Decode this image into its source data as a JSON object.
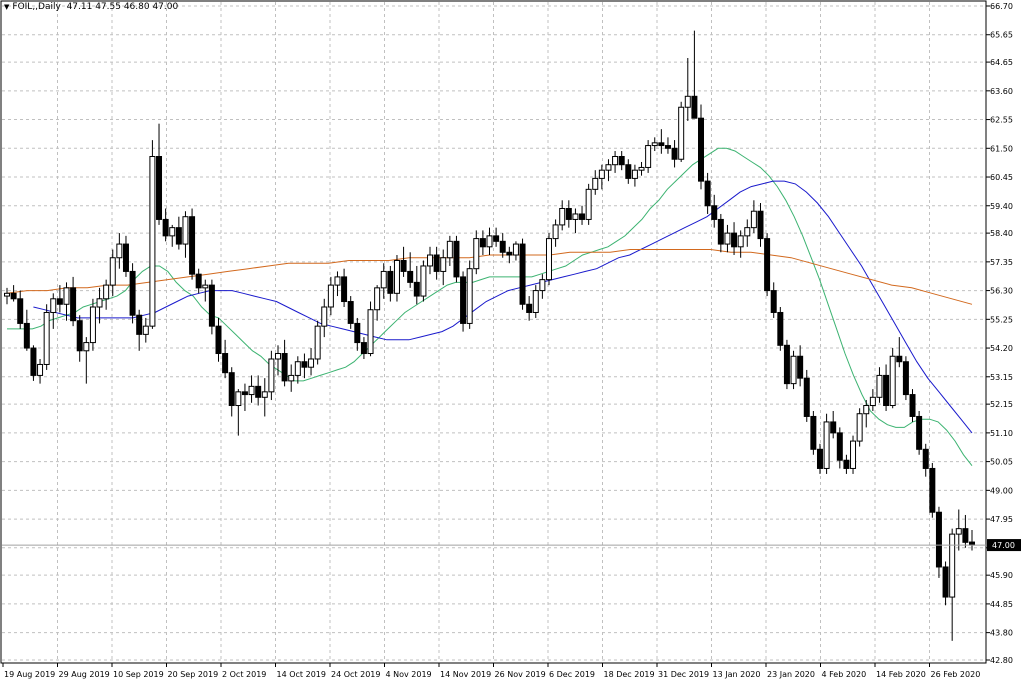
{
  "header": {
    "symbol": "FOIL,,Daily",
    "ohlc": "47.11 47.55 46.80 47.00"
  },
  "chart_data": {
    "type": "candlestick",
    "title": "FOIL,,Daily",
    "y_ticks": [
      "66.70",
      "65.65",
      "64.65",
      "63.60",
      "62.55",
      "61.50",
      "60.45",
      "59.40",
      "58.40",
      "57.35",
      "56.30",
      "55.25",
      "54.20",
      "53.15",
      "52.15",
      "51.10",
      "50.05",
      "49.00",
      "47.95",
      "46.90",
      "45.90",
      "44.85",
      "43.80",
      "42.80"
    ],
    "ylim": [
      42.8,
      66.7
    ],
    "x_ticks": [
      "19 Aug 2019",
      "29 Aug 2019",
      "10 Sep 2019",
      "20 Sep 2019",
      "2 Oct 2019",
      "14 Oct 2019",
      "24 Oct 2019",
      "4 Nov 2019",
      "14 Nov 2019",
      "26 Nov 2019",
      "6 Dec 2019",
      "18 Dec 2019",
      "31 Dec 2019",
      "13 Jan 2020",
      "23 Jan 2020",
      "4 Feb 2020",
      "14 Feb 2020",
      "26 Feb 2020"
    ],
    "current_price": "47.00",
    "grid": true,
    "colors": {
      "bull": "#ffffff",
      "bear": "#000000",
      "ma_fast": "#3cb371",
      "ma_mid": "#1a1acc",
      "ma_slow": "#d2691e",
      "grid": "#c0c0c0"
    },
    "candles": [
      [
        56.1,
        56.4,
        55.8,
        56.2
      ],
      [
        56.2,
        56.5,
        55.9,
        56.0
      ],
      [
        56.0,
        56.3,
        54.9,
        55.1
      ],
      [
        55.1,
        55.6,
        54.1,
        54.2
      ],
      [
        54.2,
        54.3,
        53.0,
        53.2
      ],
      [
        53.2,
        53.8,
        52.9,
        53.6
      ],
      [
        53.6,
        55.8,
        53.4,
        55.5
      ],
      [
        55.5,
        56.2,
        54.9,
        56.0
      ],
      [
        56.0,
        56.5,
        55.5,
        55.8
      ],
      [
        55.8,
        56.6,
        55.2,
        56.4
      ],
      [
        56.4,
        56.8,
        55.0,
        55.2
      ],
      [
        55.2,
        55.4,
        53.7,
        54.1
      ],
      [
        54.1,
        54.6,
        52.9,
        54.4
      ],
      [
        54.4,
        56.0,
        54.1,
        55.7
      ],
      [
        55.7,
        56.4,
        55.1,
        56.0
      ],
      [
        56.0,
        56.7,
        55.6,
        56.5
      ],
      [
        56.5,
        57.8,
        56.1,
        57.5
      ],
      [
        57.5,
        58.4,
        57.1,
        58.0
      ],
      [
        58.0,
        58.3,
        56.8,
        57.0
      ],
      [
        57.0,
        57.3,
        55.1,
        55.4
      ],
      [
        55.4,
        55.6,
        54.1,
        54.7
      ],
      [
        54.7,
        55.3,
        54.4,
        55.0
      ],
      [
        55.0,
        61.8,
        54.9,
        61.2
      ],
      [
        61.2,
        62.4,
        58.7,
        58.9
      ],
      [
        58.9,
        59.3,
        58.1,
        58.3
      ],
      [
        58.3,
        58.7,
        57.9,
        58.6
      ],
      [
        58.6,
        59.0,
        57.8,
        58.0
      ],
      [
        58.0,
        59.2,
        57.5,
        59.0
      ],
      [
        59.0,
        59.3,
        56.7,
        56.9
      ],
      [
        56.9,
        57.1,
        56.2,
        56.4
      ],
      [
        56.4,
        56.7,
        55.9,
        56.5
      ],
      [
        56.5,
        56.7,
        54.7,
        55.0
      ],
      [
        55.0,
        55.3,
        53.7,
        54.0
      ],
      [
        54.0,
        54.5,
        53.1,
        53.3
      ],
      [
        53.3,
        53.5,
        51.7,
        52.1
      ],
      [
        52.1,
        52.7,
        51.0,
        52.6
      ],
      [
        52.6,
        52.9,
        51.9,
        52.5
      ],
      [
        52.5,
        53.2,
        52.2,
        52.8
      ],
      [
        52.8,
        53.2,
        52.1,
        52.4
      ],
      [
        52.4,
        53.1,
        51.7,
        52.6
      ],
      [
        52.6,
        54.1,
        52.3,
        53.8
      ],
      [
        53.8,
        54.3,
        53.2,
        54.0
      ],
      [
        54.0,
        54.5,
        52.8,
        53.0
      ],
      [
        53.0,
        53.6,
        52.6,
        53.2
      ],
      [
        53.2,
        53.9,
        52.9,
        53.7
      ],
      [
        53.7,
        54.0,
        53.1,
        53.5
      ],
      [
        53.5,
        54.2,
        53.2,
        53.8
      ],
      [
        53.8,
        55.2,
        53.6,
        55.0
      ],
      [
        55.0,
        56.0,
        54.6,
        55.7
      ],
      [
        55.7,
        56.8,
        55.4,
        56.5
      ],
      [
        56.5,
        57.0,
        56.1,
        56.8
      ],
      [
        56.8,
        57.1,
        55.7,
        55.9
      ],
      [
        55.9,
        56.1,
        54.9,
        55.1
      ],
      [
        55.1,
        55.3,
        54.1,
        54.4
      ],
      [
        54.4,
        54.6,
        53.8,
        54.0
      ],
      [
        54.0,
        55.9,
        53.9,
        55.6
      ],
      [
        55.6,
        56.5,
        55.2,
        56.4
      ],
      [
        56.4,
        57.3,
        56.0,
        57.0
      ],
      [
        57.0,
        57.2,
        55.9,
        56.2
      ],
      [
        56.2,
        57.6,
        55.9,
        57.4
      ],
      [
        57.4,
        57.9,
        56.8,
        57.0
      ],
      [
        57.0,
        57.7,
        56.4,
        56.6
      ],
      [
        56.6,
        57.2,
        55.8,
        56.1
      ],
      [
        56.1,
        57.4,
        55.9,
        57.2
      ],
      [
        57.2,
        57.9,
        56.9,
        57.6
      ],
      [
        57.6,
        57.9,
        56.7,
        57.0
      ],
      [
        57.0,
        57.8,
        56.5,
        57.5
      ],
      [
        57.5,
        58.3,
        57.2,
        58.1
      ],
      [
        58.1,
        58.3,
        56.6,
        56.8
      ],
      [
        56.8,
        57.0,
        54.8,
        55.1
      ],
      [
        55.1,
        57.4,
        54.9,
        57.1
      ],
      [
        57.1,
        58.5,
        56.9,
        58.2
      ],
      [
        58.2,
        58.5,
        57.6,
        57.9
      ],
      [
        57.9,
        58.6,
        57.6,
        58.3
      ],
      [
        58.3,
        58.6,
        57.9,
        58.1
      ],
      [
        58.1,
        58.4,
        57.5,
        57.7
      ],
      [
        57.7,
        57.9,
        57.3,
        57.6
      ],
      [
        57.6,
        58.1,
        57.4,
        58.0
      ],
      [
        58.0,
        58.2,
        55.6,
        55.8
      ],
      [
        55.8,
        56.1,
        55.2,
        55.5
      ],
      [
        55.5,
        56.5,
        55.3,
        56.3
      ],
      [
        56.3,
        56.9,
        56.0,
        56.7
      ],
      [
        56.7,
        58.4,
        56.5,
        58.2
      ],
      [
        58.2,
        58.9,
        57.9,
        58.7
      ],
      [
        58.7,
        59.6,
        58.5,
        59.3
      ],
      [
        59.3,
        59.6,
        58.6,
        58.9
      ],
      [
        58.9,
        59.3,
        58.4,
        59.1
      ],
      [
        59.1,
        59.4,
        58.7,
        58.9
      ],
      [
        58.9,
        60.2,
        58.7,
        60.0
      ],
      [
        60.0,
        60.7,
        59.8,
        60.4
      ],
      [
        60.4,
        60.9,
        60.0,
        60.7
      ],
      [
        60.7,
        61.1,
        60.3,
        60.9
      ],
      [
        60.9,
        61.4,
        60.6,
        61.2
      ],
      [
        61.2,
        61.4,
        60.7,
        60.9
      ],
      [
        60.9,
        61.1,
        60.2,
        60.4
      ],
      [
        60.4,
        60.9,
        60.1,
        60.7
      ],
      [
        60.7,
        61.0,
        60.5,
        60.8
      ],
      [
        60.8,
        61.8,
        60.6,
        61.6
      ],
      [
        61.6,
        61.9,
        61.4,
        61.7
      ],
      [
        61.7,
        62.2,
        61.3,
        61.6
      ],
      [
        61.6,
        61.9,
        61.3,
        61.5
      ],
      [
        61.5,
        61.8,
        60.8,
        61.1
      ],
      [
        61.1,
        63.2,
        61.0,
        63.0
      ],
      [
        63.0,
        64.8,
        62.5,
        63.4
      ],
      [
        63.4,
        65.8,
        62.8,
        62.6
      ],
      [
        62.6,
        63.1,
        60.0,
        60.3
      ],
      [
        60.3,
        60.6,
        59.1,
        59.4
      ],
      [
        59.4,
        59.8,
        58.6,
        58.9
      ],
      [
        58.9,
        59.1,
        57.7,
        58.0
      ],
      [
        58.0,
        58.7,
        57.7,
        58.4
      ],
      [
        58.4,
        58.8,
        57.6,
        57.9
      ],
      [
        57.9,
        58.5,
        57.5,
        58.3
      ],
      [
        58.3,
        58.9,
        57.9,
        58.6
      ],
      [
        58.6,
        59.6,
        58.4,
        59.2
      ],
      [
        59.2,
        59.5,
        57.9,
        58.2
      ],
      [
        58.2,
        58.4,
        56.1,
        56.3
      ],
      [
        56.3,
        56.6,
        55.3,
        55.5
      ],
      [
        55.5,
        55.7,
        54.1,
        54.3
      ],
      [
        54.3,
        54.5,
        52.7,
        52.9
      ],
      [
        52.9,
        54.1,
        52.7,
        53.9
      ],
      [
        53.9,
        54.3,
        52.8,
        53.1
      ],
      [
        53.1,
        53.4,
        51.5,
        51.7
      ],
      [
        51.7,
        51.9,
        50.3,
        50.5
      ],
      [
        50.5,
        50.7,
        49.6,
        49.8
      ],
      [
        49.8,
        51.8,
        49.6,
        51.5
      ],
      [
        51.5,
        51.9,
        50.9,
        51.1
      ],
      [
        51.1,
        51.3,
        49.8,
        50.1
      ],
      [
        50.1,
        50.3,
        49.6,
        49.8
      ],
      [
        49.8,
        51.0,
        49.6,
        50.8
      ],
      [
        50.8,
        52.0,
        50.6,
        51.8
      ],
      [
        51.8,
        52.3,
        51.3,
        52.1
      ],
      [
        52.1,
        52.7,
        51.9,
        52.4
      ],
      [
        52.4,
        53.5,
        52.2,
        53.2
      ],
      [
        53.2,
        53.6,
        51.9,
        52.1
      ],
      [
        52.1,
        54.2,
        52.0,
        53.9
      ],
      [
        53.9,
        54.6,
        53.5,
        53.7
      ],
      [
        53.7,
        53.9,
        52.3,
        52.5
      ],
      [
        52.5,
        52.7,
        51.5,
        51.7
      ],
      [
        51.7,
        51.9,
        50.3,
        50.5
      ],
      [
        50.5,
        50.7,
        49.5,
        49.8
      ],
      [
        49.8,
        50.0,
        48.0,
        48.2
      ],
      [
        48.2,
        48.4,
        45.8,
        46.2
      ],
      [
        46.2,
        46.4,
        44.8,
        45.1
      ],
      [
        45.1,
        47.6,
        43.5,
        47.4
      ],
      [
        47.4,
        48.3,
        46.8,
        47.6
      ],
      [
        47.6,
        48.1,
        46.9,
        47.1
      ],
      [
        47.11,
        47.55,
        46.8,
        47.0
      ]
    ],
    "ma_fast": [
      54.9,
      54.9,
      54.9,
      54.9,
      55.0,
      55.2,
      55.3,
      55.4,
      55.5,
      55.7,
      55.8,
      55.9,
      56.0,
      56.1,
      56.3,
      56.7,
      57.0,
      57.2,
      57.2,
      57.0,
      56.6,
      56.3,
      56.1,
      55.7,
      55.4,
      55.3,
      55.0,
      54.7,
      54.4,
      54.1,
      53.9,
      53.6,
      53.4,
      53.2,
      53.0,
      53.0,
      53.1,
      53.2,
      53.3,
      53.4,
      53.5,
      53.7,
      54.0,
      54.3,
      54.6,
      54.9,
      55.2,
      55.5,
      55.7,
      55.9,
      56.1,
      56.3,
      56.5,
      56.6,
      56.6,
      56.6,
      56.7,
      56.8,
      56.8,
      56.8,
      56.8,
      56.8,
      56.8,
      56.9,
      57.0,
      57.1,
      57.2,
      57.4,
      57.6,
      57.7,
      57.8,
      57.9,
      58.1,
      58.3,
      58.6,
      58.9,
      59.3,
      59.6,
      60.0,
      60.3,
      60.6,
      60.9,
      61.1,
      61.3,
      61.5,
      61.5,
      61.4,
      61.2,
      61.0,
      60.8,
      60.5,
      60.1,
      59.6,
      59.0,
      58.3,
      57.5,
      56.7,
      55.8,
      54.9,
      54.0,
      53.2,
      52.5,
      51.9,
      51.6,
      51.4,
      51.3,
      51.3,
      51.5,
      51.6,
      51.6,
      51.5,
      51.2,
      50.8,
      50.3,
      49.9
    ],
    "ma_fast_start": 0,
    "ma_mid": [
      55.7,
      55.6,
      55.5,
      55.4,
      55.3,
      55.3,
      55.3,
      55.3,
      55.3,
      55.3,
      55.4,
      55.5,
      55.7,
      55.9,
      56.1,
      56.2,
      56.3,
      56.3,
      56.3,
      56.2,
      56.1,
      56.0,
      55.9,
      55.7,
      55.5,
      55.3,
      55.1,
      55.0,
      54.9,
      54.8,
      54.7,
      54.6,
      54.5,
      54.5,
      54.5,
      54.6,
      54.7,
      54.8,
      55.0,
      55.3,
      55.6,
      55.9,
      56.1,
      56.3,
      56.4,
      56.5,
      56.6,
      56.7,
      56.8,
      56.9,
      57.0,
      57.1,
      57.3,
      57.5,
      57.6,
      57.8,
      58.0,
      58.2,
      58.4,
      58.6,
      58.8,
      59.0,
      59.3,
      59.6,
      59.9,
      60.1,
      60.2,
      60.3,
      60.3,
      60.2,
      59.9,
      59.5,
      59.0,
      58.4,
      57.8,
      57.2,
      56.5,
      55.8,
      55.1,
      54.4,
      53.7,
      53.1,
      52.6,
      52.1,
      51.6,
      51.1
    ],
    "ma_slow": [
      56.2,
      56.3,
      56.3,
      56.4,
      56.4,
      56.5,
      56.5,
      56.6,
      56.7,
      56.8,
      56.9,
      57.0,
      57.1,
      57.2,
      57.3,
      57.3,
      57.3,
      57.4,
      57.4,
      57.4,
      57.5,
      57.5,
      57.5,
      57.5,
      57.6,
      57.6,
      57.6,
      57.6,
      57.7,
      57.7,
      57.7,
      57.8,
      57.8,
      57.8,
      57.8,
      57.8,
      57.7,
      57.7,
      57.6,
      57.5,
      57.3,
      57.1,
      56.9,
      56.7,
      56.5,
      56.4,
      56.2,
      56.0,
      55.8
    ]
  }
}
